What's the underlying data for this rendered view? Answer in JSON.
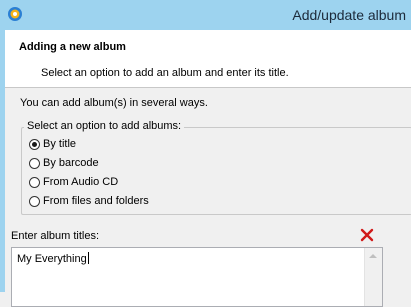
{
  "window": {
    "title": "Add/update album",
    "titlebar_color": "#9dd3ef",
    "app_icon": "app-logo-icon"
  },
  "header": {
    "title": "Adding a new album",
    "description": "Select an option to add an album and enter its title."
  },
  "intro_text": "You can add album(s) in several ways.",
  "options_group": {
    "label": "Select an option to add albums:",
    "options": [
      {
        "label": "By title",
        "checked": true
      },
      {
        "label": "By barcode",
        "checked": false
      },
      {
        "label": "From Audio CD",
        "checked": false
      },
      {
        "label": "From files and folders",
        "checked": false
      }
    ]
  },
  "titles": {
    "label": "Enter album titles:",
    "value": "My Everything",
    "clear_icon": "red-x-icon"
  }
}
